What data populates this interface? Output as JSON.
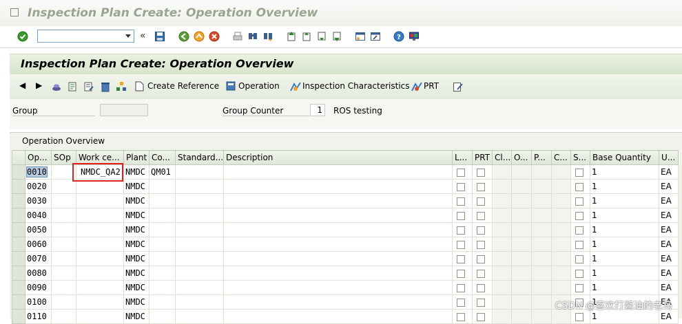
{
  "window": {
    "title": "Inspection Plan Create: Operation Overview"
  },
  "toolbar": {
    "command_value": "",
    "icons": [
      "enter-icon",
      "save-icon",
      "back-icon",
      "exit-icon",
      "cancel-icon",
      "print-icon",
      "find-icon",
      "find-next-icon",
      "first-page-icon",
      "previous-page-icon",
      "next-page-icon",
      "last-page-icon",
      "new-session-icon",
      "shortcut-icon",
      "help-icon",
      "layout-icon"
    ]
  },
  "app": {
    "title": "Inspection Plan Create: Operation Overview",
    "buttons": {
      "create_reference": "Create Reference",
      "operation": "Operation",
      "inspection_characteristics": "Inspection Characteristics",
      "prt": "PRT"
    }
  },
  "header": {
    "group_label": "Group",
    "group_value": "",
    "group_counter_label": "Group Counter",
    "group_counter_value": "1",
    "group_counter_text": "ROS testing"
  },
  "table": {
    "title": "Operation Overview",
    "columns": [
      "Op...",
      "SOp",
      "Work ce...",
      "Plant",
      "Co...",
      "Standard...",
      "Description",
      "L...",
      "PRT",
      "Cl...",
      "O...",
      "P...",
      "C...",
      "S...",
      "Base Quantity",
      "U..."
    ],
    "rows": [
      {
        "op": "0010",
        "sop": "",
        "work_center": "NMDC_QA2",
        "plant": "NMDC",
        "control": "QM01",
        "base_qty": "1",
        "unit": "EA"
      },
      {
        "op": "0020",
        "sop": "",
        "work_center": "",
        "plant": "NMDC",
        "control": "",
        "base_qty": "1",
        "unit": "EA"
      },
      {
        "op": "0030",
        "sop": "",
        "work_center": "",
        "plant": "NMDC",
        "control": "",
        "base_qty": "1",
        "unit": "EA"
      },
      {
        "op": "0040",
        "sop": "",
        "work_center": "",
        "plant": "NMDC",
        "control": "",
        "base_qty": "1",
        "unit": "EA"
      },
      {
        "op": "0050",
        "sop": "",
        "work_center": "",
        "plant": "NMDC",
        "control": "",
        "base_qty": "1",
        "unit": "EA"
      },
      {
        "op": "0060",
        "sop": "",
        "work_center": "",
        "plant": "NMDC",
        "control": "",
        "base_qty": "1",
        "unit": "EA"
      },
      {
        "op": "0070",
        "sop": "",
        "work_center": "",
        "plant": "NMDC",
        "control": "",
        "base_qty": "1",
        "unit": "EA"
      },
      {
        "op": "0080",
        "sop": "",
        "work_center": "",
        "plant": "NMDC",
        "control": "",
        "base_qty": "1",
        "unit": "EA"
      },
      {
        "op": "0090",
        "sop": "",
        "work_center": "",
        "plant": "NMDC",
        "control": "",
        "base_qty": "1",
        "unit": "EA"
      },
      {
        "op": "0100",
        "sop": "",
        "work_center": "",
        "plant": "NMDC",
        "control": "",
        "base_qty": "1",
        "unit": "EA"
      },
      {
        "op": "0110",
        "sop": "",
        "work_center": "",
        "plant": "NMDC",
        "control": "",
        "base_qty": "1",
        "unit": "EA"
      }
    ]
  },
  "watermark": "CSDN @喜欢打酱油的老鸟"
}
